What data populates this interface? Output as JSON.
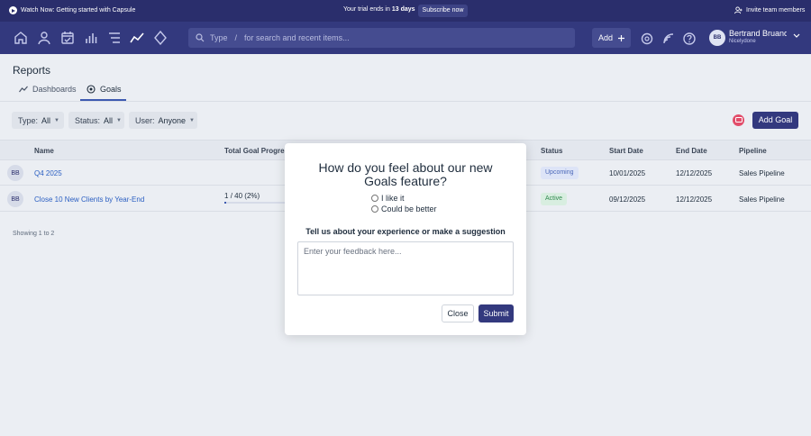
{
  "topbar": {
    "watch_text": "Watch Now: Getting started with Capsule",
    "trial_prefix": "Your trial ends in",
    "trial_days": "13 days",
    "subscribe_label": "Subscribe now",
    "invite_label": "Invite team members"
  },
  "nav": {
    "search_type_label": "Type",
    "search_slash": "/",
    "search_placeholder": "for search and recent items...",
    "add_label": "Add",
    "user_name": "Bertrand Bruandet",
    "user_org": "Nicelydone",
    "user_initials": "BB"
  },
  "page": {
    "title": "Reports",
    "tabs": [
      {
        "label": "Dashboards",
        "active": false
      },
      {
        "label": "Goals",
        "active": true
      }
    ]
  },
  "filters": [
    {
      "label": "Type:",
      "value": "All"
    },
    {
      "label": "Status:",
      "value": "All"
    },
    {
      "label": "User:",
      "value": "Anyone"
    }
  ],
  "add_goal_label": "Add Goal",
  "table": {
    "headers": [
      "Name",
      "Total Goal Progress",
      "Status",
      "Start Date",
      "End Date",
      "Pipeline"
    ],
    "rows": [
      {
        "initials": "BB",
        "name": "Q4 2025",
        "progress_text": "",
        "status": "Upcoming",
        "start": "10/01/2025",
        "end": "12/12/2025",
        "pipeline": "Sales Pipeline"
      },
      {
        "initials": "BB",
        "name": "Close 10 New Clients by Year-End",
        "progress_current": "1",
        "progress_sep": "/",
        "progress_total": "40",
        "progress_pct": "(2%)",
        "progress_fraction": 0.025,
        "status": "Active",
        "start": "09/12/2025",
        "end": "12/12/2025",
        "pipeline": "Sales Pipeline"
      }
    ]
  },
  "showing_text": "Showing 1 to 2",
  "modal": {
    "question": "How do you feel about our new Goals feature?",
    "options": [
      "I like it",
      "Could be better"
    ],
    "prompt": "Tell us about your experience or make a suggestion",
    "textarea_placeholder": "Enter your feedback here...",
    "close_label": "Close",
    "submit_label": "Submit"
  },
  "colors": {
    "topbar": "#2a2e6c",
    "navbar": "#33397e",
    "accent": "#3d5ab0",
    "link": "#2b5fc2"
  }
}
